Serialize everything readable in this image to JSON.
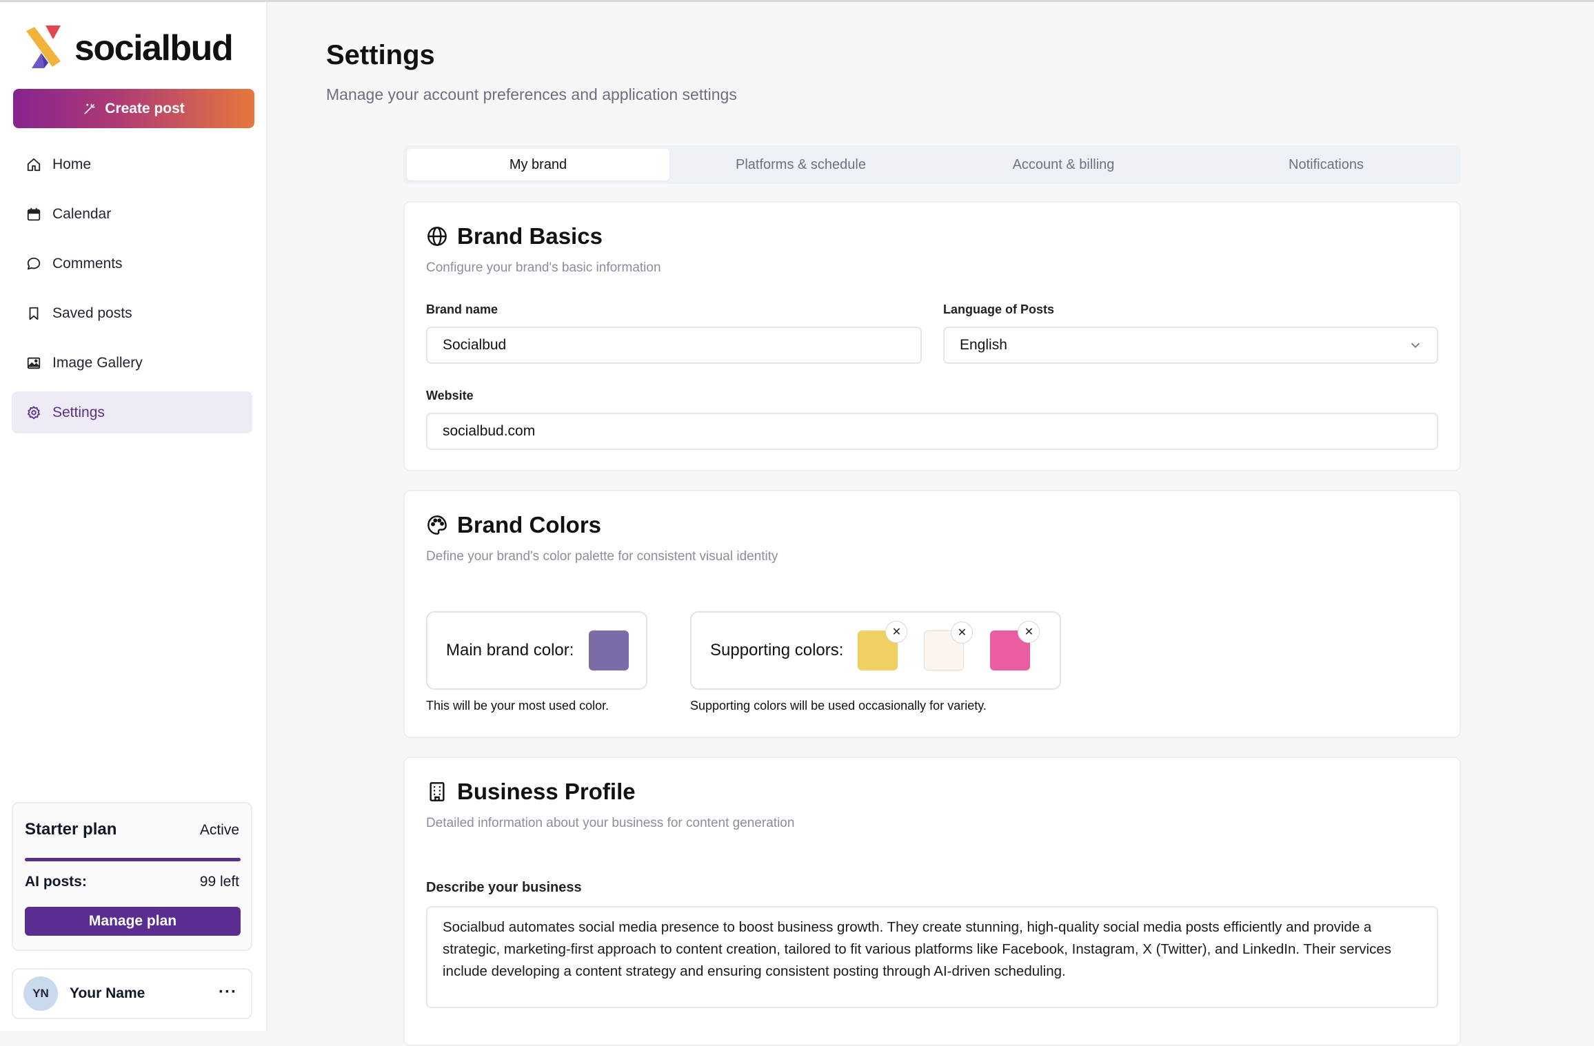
{
  "app": {
    "name": "socialbud"
  },
  "sidebar": {
    "create_button": "Create post",
    "items": [
      {
        "label": "Home",
        "icon": "home-icon"
      },
      {
        "label": "Calendar",
        "icon": "calendar-icon"
      },
      {
        "label": "Comments",
        "icon": "chat-bubble-icon"
      },
      {
        "label": "Saved posts",
        "icon": "bookmark-icon"
      },
      {
        "label": "Image Gallery",
        "icon": "image-icon"
      },
      {
        "label": "Settings",
        "icon": "gear-icon",
        "active": true
      }
    ],
    "plan": {
      "name": "Starter plan",
      "status": "Active",
      "usage_fraction": 1.0,
      "ai_label": "AI posts:",
      "ai_value": "99 left",
      "manage_button": "Manage plan"
    },
    "user": {
      "initials": "YN",
      "name": "Your Name",
      "more": "···"
    }
  },
  "page": {
    "title": "Settings",
    "subtitle": "Manage your account preferences and application settings"
  },
  "tabs": [
    {
      "label": "My brand",
      "active": true
    },
    {
      "label": "Platforms & schedule"
    },
    {
      "label": "Account & billing"
    },
    {
      "label": "Notifications"
    }
  ],
  "brand_basics": {
    "title": "Brand Basics",
    "subtitle": "Configure your brand's basic information",
    "brand_name_label": "Brand name",
    "brand_name_value": "Socialbud",
    "language_label": "Language of Posts",
    "language_value": "English",
    "website_label": "Website",
    "website_value": "socialbud.com"
  },
  "brand_colors": {
    "title": "Brand Colors",
    "subtitle": "Define your brand's color palette for consistent visual identity",
    "main_label": "Main brand color:",
    "main_color": "#7b6ba6",
    "main_hint": "This will be your most used color.",
    "supporting_label": "Supporting colors:",
    "supporting_colors": [
      "#f0cf63",
      "#fdf5f0",
      "#e95da1"
    ],
    "remove_glyph": "✕",
    "supporting_hint": "Supporting colors will be used occasionally for variety."
  },
  "business_profile": {
    "title": "Business Profile",
    "subtitle": "Detailed information about your business for content generation",
    "describe_label": "Describe your business",
    "describe_value": "Socialbud automates social media presence to boost business growth. They create stunning, high-quality social media posts efficiently and provide a strategic, marketing-first approach to content creation, tailored to fit various platforms like Facebook, Instagram, X (Twitter), and LinkedIn. Their services include developing a content strategy and ensuring consistent posting through AI-driven scheduling."
  }
}
